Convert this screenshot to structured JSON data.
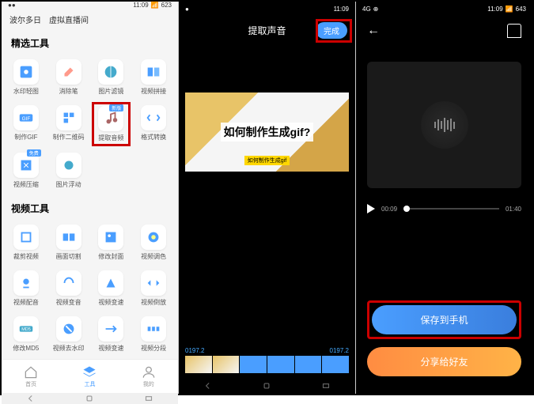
{
  "status": {
    "time": "11:09",
    "battery_p1": "623",
    "battery_p3": "643"
  },
  "p1": {
    "header_tabs": [
      "波尔多日",
      "虚拟直播间"
    ],
    "section1_title": "精选工具",
    "featured": [
      {
        "label": "水印轻图",
        "icon": "watermark"
      },
      {
        "label": "消除笔",
        "icon": "eraser"
      },
      {
        "label": "图片滤镜",
        "icon": "filter"
      },
      {
        "label": "视频拼接",
        "icon": "vjoin"
      },
      {
        "label": "制作GIF",
        "icon": "gif"
      },
      {
        "label": "制作二维码",
        "icon": "qr"
      },
      {
        "label": "提取音频",
        "icon": "music",
        "highlight": true,
        "badge": "新版"
      },
      {
        "label": "格式转换",
        "icon": "convert"
      },
      {
        "label": "视频压缩",
        "icon": "compress",
        "badge": "免费"
      },
      {
        "label": "图片浮动",
        "icon": "float"
      }
    ],
    "section2_title": "视频工具",
    "video_tools": [
      {
        "label": "裁剪视频",
        "icon": "crop"
      },
      {
        "label": "画面切割",
        "icon": "split"
      },
      {
        "label": "修改封面",
        "icon": "cover"
      },
      {
        "label": "视频调色",
        "icon": "color"
      },
      {
        "label": "视频配音",
        "icon": "dub"
      },
      {
        "label": "视频变音",
        "icon": "voice"
      },
      {
        "label": "视频变速",
        "icon": "speed"
      },
      {
        "label": "视频倒放",
        "icon": "reverse"
      },
      {
        "label": "修改MD5",
        "icon": "md5"
      },
      {
        "label": "视频去水印",
        "icon": "dewat"
      },
      {
        "label": "视频变速",
        "icon": "speed2"
      },
      {
        "label": "视频分段",
        "icon": "seg"
      }
    ],
    "nav": [
      {
        "label": "首页",
        "icon": "home"
      },
      {
        "label": "工具",
        "icon": "tools",
        "active": true
      },
      {
        "label": "我的",
        "icon": "me"
      }
    ]
  },
  "p2": {
    "title": "提取声音",
    "done": "完成",
    "video_text": "如何制作生成gif?",
    "video_sub": "如何制作生成gif",
    "time_start": "0197.2",
    "time_end": "0197.2"
  },
  "p3": {
    "time_current": "00:09",
    "time_total": "01:40",
    "save_btn": "保存到手机",
    "share_btn": "分享给好友"
  }
}
